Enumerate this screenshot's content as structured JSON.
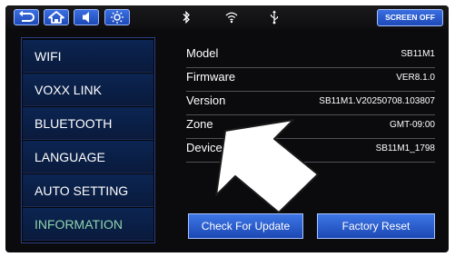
{
  "topbar": {
    "back_icon": "back-arrow-icon",
    "home_icon": "home-icon",
    "volume_icon": "speaker-icon",
    "brightness_icon": "sun-icon",
    "bluetooth_icon": "bluetooth-icon",
    "wifi_icon": "wifi-icon",
    "usb_icon": "usb-icon",
    "screen_off_label": "SCREEN OFF"
  },
  "sidebar": {
    "items": [
      {
        "label": "WIFI"
      },
      {
        "label": "VOXX LINK"
      },
      {
        "label": "BLUETOOTH"
      },
      {
        "label": "LANGUAGE"
      },
      {
        "label": "AUTO SETTING"
      },
      {
        "label": "INFORMATION"
      }
    ],
    "active_item": "INFORMATION"
  },
  "info": {
    "rows": [
      {
        "label": "Model",
        "value": "SB11M1"
      },
      {
        "label": "Firmware",
        "value": "VER8.1.0"
      },
      {
        "label": "Version",
        "value": "SB11M1.V20250708.103807"
      },
      {
        "label": "Zone",
        "value": "GMT-09:00"
      },
      {
        "label": "Device",
        "value": "SB11M1_1798"
      }
    ]
  },
  "buttons": {
    "check_update": "Check For Update",
    "factory_reset": "Factory Reset"
  },
  "colors": {
    "accent_blue": "#2a5fd6",
    "active_item_text": "#8fd4ad",
    "background": "#0b0b0d"
  },
  "overlay": {
    "pointer_icon": "arrow-pointer-icon"
  }
}
